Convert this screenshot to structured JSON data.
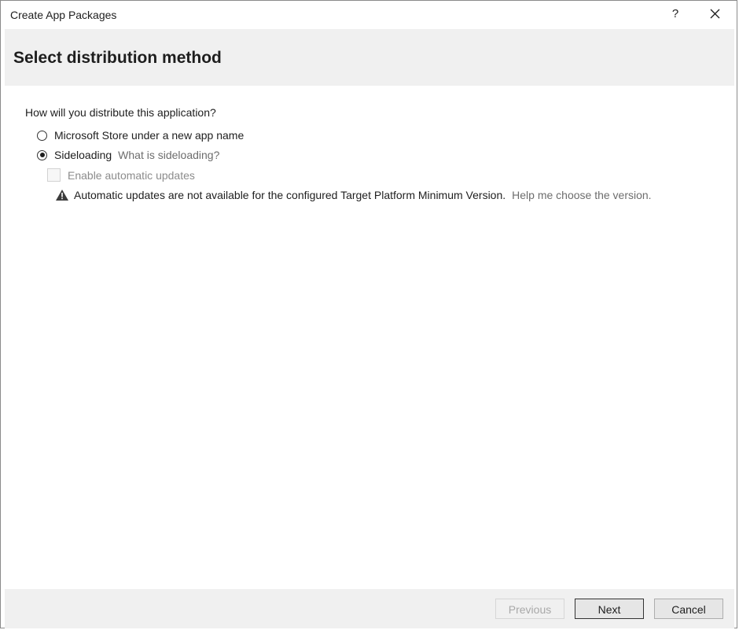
{
  "window": {
    "title": "Create App Packages",
    "help_glyph": "?",
    "close_icon": "close-icon"
  },
  "header": {
    "title": "Select distribution method"
  },
  "main": {
    "question": "How will you distribute this application?",
    "options": [
      {
        "label": "Microsoft Store under a new app name",
        "selected": false
      },
      {
        "label": "Sideloading",
        "selected": true,
        "link": "What is sideloading?"
      }
    ],
    "auto_updates": {
      "label": "Enable automatic updates",
      "checked": false,
      "enabled": false
    },
    "warning": {
      "icon": "warning-icon",
      "text": "Automatic updates are not available for the configured Target Platform Minimum Version.",
      "link": "Help me choose the version."
    }
  },
  "footer": {
    "previous_label": "Previous",
    "next_label": "Next",
    "cancel_label": "Cancel"
  },
  "colors": {
    "header_band": "#f0f0f0",
    "link": "#6d6d6d",
    "disabled_text": "#8c8c8c"
  }
}
